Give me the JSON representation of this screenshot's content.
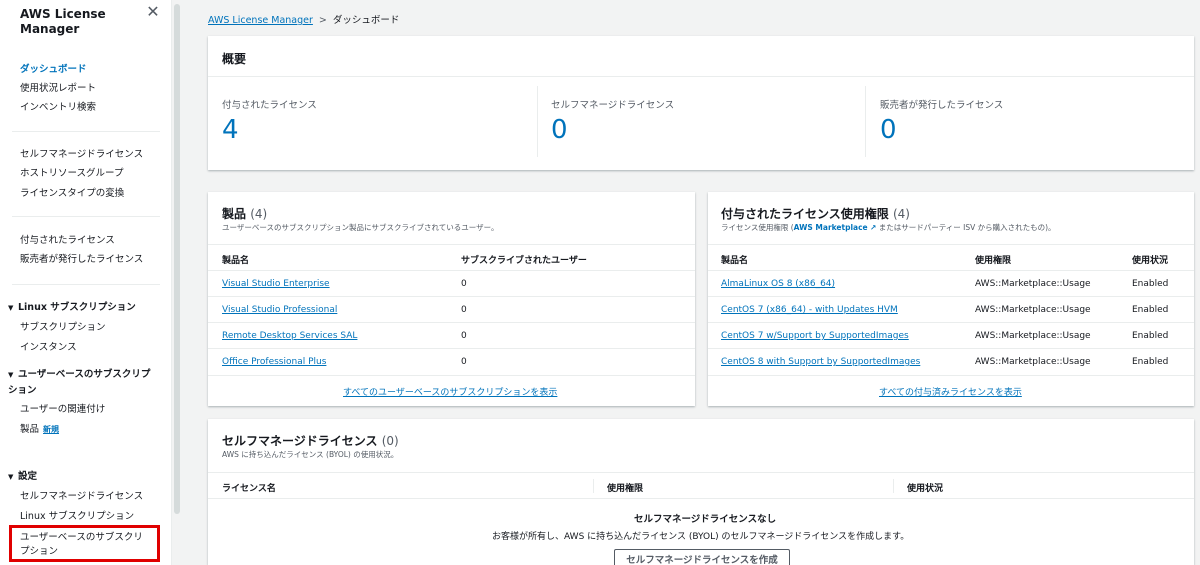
{
  "sidebar": {
    "title": "AWS License Manager",
    "close_icon": "close-icon",
    "items": [
      {
        "label": "ダッシュボード"
      },
      {
        "label": "使用状況レポート"
      },
      {
        "label": "インベントリ検索"
      },
      {
        "label": "セルフマネージドライセンス"
      },
      {
        "label": "ホストリソースグループ"
      },
      {
        "label": "ライセンスタイプの変換"
      },
      {
        "label": "付与されたライセンス"
      },
      {
        "label": "販売者が発行したライセンス"
      }
    ],
    "sections": [
      {
        "label": "Linux サブスクリプション",
        "items": [
          "サブスクリプション",
          "インスタンス"
        ]
      },
      {
        "label": "ユーザーベースのサブスクリプション",
        "items": [
          "ユーザーの関連付け",
          "製品"
        ],
        "new_badge": "新規"
      },
      {
        "label": "設定",
        "items": [
          "セルフマネージドライセンス",
          "Linux サブスクリプション",
          "ユーザーベースのサブスクリプション"
        ]
      }
    ],
    "highlight_color": "#e00000"
  },
  "breadcrumb": {
    "root": "AWS License Manager",
    "current": "ダッシュボード"
  },
  "overview": {
    "title": "概要",
    "stats": [
      {
        "label": "付与されたライセンス",
        "value": "4"
      },
      {
        "label": "セルフマネージドライセンス",
        "value": "0"
      },
      {
        "label": "販売者が発行したライセンス",
        "value": "0"
      }
    ]
  },
  "products": {
    "title": "製品",
    "count": "(4)",
    "description": "ユーザーベースのサブスクリプション製品にサブスクライブされているユーザー。",
    "columns": [
      "製品名",
      "サブスクライブされたユーザー"
    ],
    "rows": [
      {
        "name": "Visual Studio Enterprise",
        "users": "0"
      },
      {
        "name": "Visual Studio Professional",
        "users": "0"
      },
      {
        "name": "Remote Desktop Services SAL",
        "users": "0"
      },
      {
        "name": "Office Professional Plus",
        "users": "0"
      }
    ],
    "view_all": "すべてのユーザーベースのサブスクリプションを表示"
  },
  "granted": {
    "title": "付与されたライセンス使用権限",
    "count": "(4)",
    "desc_prefix": "ライセンス使用権限 (",
    "desc_link": "AWS Marketplace",
    "desc_suffix": " またはサードパーティー ISV から購入されたもの)。",
    "external_icon": "external-link-icon",
    "columns": [
      "製品名",
      "使用権限",
      "使用状況"
    ],
    "rows": [
      {
        "name": "AlmaLinux OS 8 (x86_64)",
        "entitlement": "AWS::Marketplace::Usage",
        "status": "Enabled"
      },
      {
        "name": "CentOS 7 (x86_64) - with Updates HVM",
        "entitlement": "AWS::Marketplace::Usage",
        "status": "Enabled"
      },
      {
        "name": "CentOS 7 w/Support by SupportedImages",
        "entitlement": "AWS::Marketplace::Usage",
        "status": "Enabled"
      },
      {
        "name": "CentOS 8 with Support by SupportedImages",
        "entitlement": "AWS::Marketplace::Usage",
        "status": "Enabled"
      }
    ],
    "view_all": "すべての付与済みライセンスを表示"
  },
  "selfmanaged": {
    "title": "セルフマネージドライセンス",
    "count": "(0)",
    "description": "AWS に持ち込んだライセンス (BYOL) の使用状況。",
    "columns": [
      "ライセンス名",
      "使用権限",
      "使用状況"
    ],
    "empty_title": "セルフマネージドライセンスなし",
    "empty_desc": "お客様が所有し、AWS に持ち込んだライセンス (BYOL) のセルフマネージドライセンスを作成します。",
    "create_button": "セルフマネージドライセンスを作成"
  }
}
